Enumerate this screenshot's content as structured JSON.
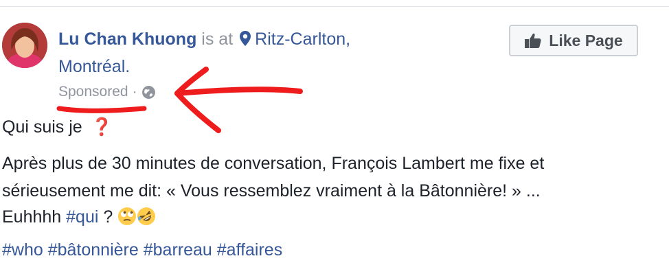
{
  "post": {
    "author": "Lu Chan Khuong",
    "is_at": "is at",
    "place_line1": "Ritz-Carlton,",
    "place_line2": "Montréal.",
    "sponsored": "Sponsored",
    "dot": "·",
    "like_page_label": "Like Page",
    "line_question": "Qui suis je",
    "question_icon": "❓",
    "body_line1": "Après plus de 30 minutes de conversation, François Lambert me fixe et",
    "body_line2": "sérieusement me dit: « Vous ressemblez vraiment à la Bâtonnière! » ...",
    "body_line3_start": "Euhhhh",
    "body_hashtag_qui": "#qui",
    "body_line3_end": "?",
    "hashtags": [
      "#who",
      "#bâtonnière",
      "#barreau",
      "#affaires"
    ]
  },
  "icons": {
    "pin": "location-pin-icon",
    "globe": "globe-icon",
    "thumb": "thumbs-up-icon",
    "emoji1": "rolling-eyes-emoji",
    "emoji2": "rofl-emoji"
  },
  "colors": {
    "link_blue": "#365899",
    "meta_gray": "#90949c",
    "annotation_red": "#ee1c1c",
    "question_red": "#e0245e"
  }
}
